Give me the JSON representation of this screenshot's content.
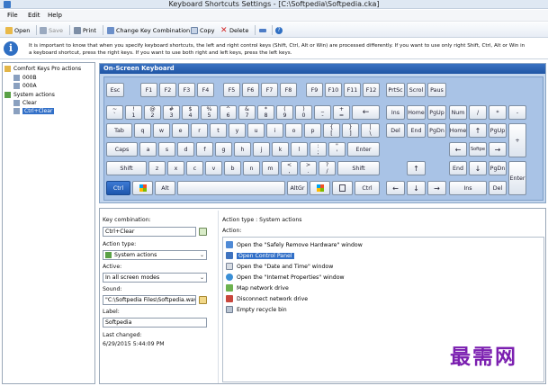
{
  "window": {
    "title": "Keyboard Shortcuts Settings - [C:\\Softpedia\\Softpedia.cka]"
  },
  "menu": [
    "File",
    "Edit",
    "Help"
  ],
  "toolbar": {
    "open": "Open",
    "save": "Save",
    "print": "Print",
    "change_combo": "Change Key Combination",
    "copy": "Copy",
    "delete": "Delete"
  },
  "info": {
    "line1": "It is important to know that when you specify keyboard shortcuts, the left and right control keys (Shift, Ctrl, Alt or Win) are processed differently. If you want to use only right Shift, Ctrl, Alt or Win in",
    "line2": "a keyboard shortcut, press the right keys. If you want to use both right and left keys, press the left keys."
  },
  "tree": {
    "items": [
      "Comfort Keys Pro actions",
      "000B",
      "000A",
      "System actions",
      "Clear",
      "Ctrl+Clear"
    ]
  },
  "keyboard": {
    "title": "On-Screen Keyboard",
    "selected_key": "Ctrl"
  },
  "form": {
    "key_combination_label": "Key combination:",
    "key_combination_value": "Ctrl+Clear",
    "action_type_label": "Action type:",
    "action_type_value": "System actions",
    "active_label": "Active:",
    "active_value": "In all screen modes",
    "sound_label": "Sound:",
    "sound_value": "\"C:\\Softpedia Files\\Softpedia.wav\"",
    "label_label": "Label:",
    "label_value": "Softpedia",
    "last_changed_label": "Last changed:",
    "last_changed_value": "6/29/2015 5:44:09 PM"
  },
  "action_panel": {
    "type_label": "Action type : System actions",
    "action_label": "Action:",
    "items": [
      "Open the \"Safely Remove Hardware\" window",
      "Open Control Panel",
      "Open the \"Date and Time\" window",
      "Open the \"Internet Properties\" window",
      "Map network drive",
      "Disconnect network drive",
      "Empty recycle bin"
    ],
    "selected_index": 1
  },
  "watermark": "最需网",
  "colors": {
    "accent": "#2f68bd",
    "keyboard_bg": "#a9c3e6",
    "selection": "#3270c8"
  }
}
